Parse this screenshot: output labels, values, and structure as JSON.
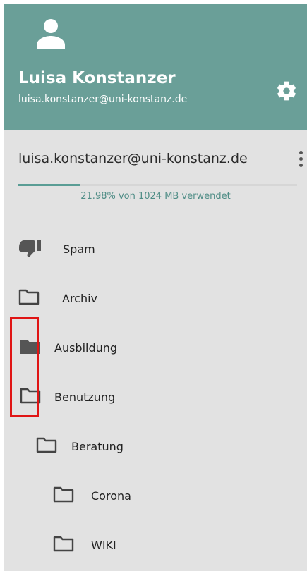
{
  "header": {
    "user_name": "Luisa Konstanzer",
    "user_email": "luisa.konstanzer@uni-konstanz.de",
    "avatar_icon": "person-icon",
    "settings_icon": "gear-icon",
    "background_color": "#6a9f98"
  },
  "account": {
    "email": "luisa.konstanzer@uni-konstanz.de",
    "menu_icon": "kebab-menu-icon",
    "quota_text": "21.98% von 1024 MB verwendet",
    "quota_percent": 21.98
  },
  "folders": [
    {
      "label": "Spam",
      "icon": "thumbs-down-icon"
    },
    {
      "label": "Archiv",
      "icon": "folder-outline-icon"
    },
    {
      "label": "Ausbildung",
      "icon": "folder-filled-icon"
    },
    {
      "label": "Benutzung",
      "icon": "folder-outline-icon"
    },
    {
      "label": "Beratung",
      "icon": "folder-outline-icon"
    },
    {
      "label": "Corona",
      "icon": "folder-outline-icon"
    },
    {
      "label": "WIKI",
      "icon": "folder-outline-icon"
    }
  ],
  "highlight_color": "#e01515"
}
